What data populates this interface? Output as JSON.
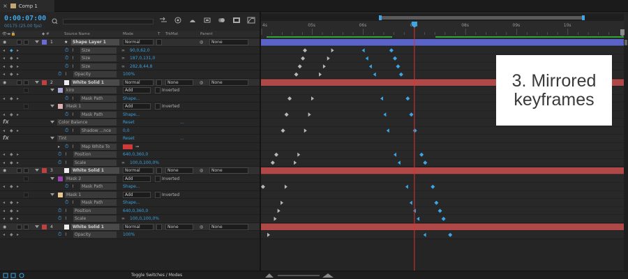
{
  "tab": {
    "title": "Comp 1"
  },
  "header": {
    "timecode": "0:00:07:00",
    "fps_label": "00175 (25.00 fps)"
  },
  "columns": {
    "source_name": "Source Name",
    "mode": "Mode",
    "t": "T",
    "trkmat": "TrkMat",
    "parent": "Parent"
  },
  "ruler": {
    "labels": [
      "4s",
      "05s",
      "06s",
      "07s",
      "08s",
      "09s",
      "10s"
    ]
  },
  "rows": [
    {
      "kind": "layer",
      "num": "1",
      "name": "Shape Layer 1",
      "label_color": "#6b6bd6",
      "mode": "Normal",
      "parent": "None",
      "star": true
    },
    {
      "kind": "prop",
      "indent": 2,
      "name": "Size",
      "value": "90,0,62,0",
      "icon": "stopwatch"
    },
    {
      "kind": "prop",
      "indent": 2,
      "name": "Size",
      "value": "187,0,131,0",
      "icon": "stopwatch"
    },
    {
      "kind": "prop",
      "indent": 2,
      "name": "Size",
      "value": "282,8,44,8",
      "icon": "stopwatch"
    },
    {
      "kind": "prop",
      "indent": 1,
      "name": "Opacity",
      "value": "100%",
      "icon": "stopwatch"
    },
    {
      "kind": "layer",
      "num": "2",
      "name": "White Solid 1",
      "label_color": "#c04040",
      "mode": "Normal",
      "trkmat": "None",
      "parent": "None"
    },
    {
      "kind": "mask",
      "name": "kiro",
      "mask_color": "#a9a9d8",
      "mode": "Add",
      "inverted": "Inverted"
    },
    {
      "kind": "prop",
      "indent": 2,
      "name": "Mask Path",
      "value": "Shape...",
      "icon": "stopwatch"
    },
    {
      "kind": "mask",
      "name": "Mask 1",
      "mask_color": "#e0b0b0",
      "mode": "Add",
      "inverted": "Inverted"
    },
    {
      "kind": "prop",
      "indent": 2,
      "name": "Mask Path",
      "value": "Shape...",
      "icon": "stopwatch"
    },
    {
      "kind": "effect",
      "name": "Color Balance",
      "value": "Reset",
      "extra": "..."
    },
    {
      "kind": "prop",
      "indent": 2,
      "name": "Shadow ...nce",
      "value": "0,0",
      "icon": "stopwatch"
    },
    {
      "kind": "effect",
      "name": "Tint",
      "value": "Reset",
      "extra": "..."
    },
    {
      "kind": "propcolor",
      "indent": 2,
      "name": "Map White To",
      "color": "#d23a3a"
    },
    {
      "kind": "prop",
      "indent": 1,
      "name": "Position",
      "value": "640,0,360,0",
      "icon": "stopwatch"
    },
    {
      "kind": "prop",
      "indent": 1,
      "name": "Scale",
      "value": "100,0,100,0%",
      "icon": "stopwatch"
    },
    {
      "kind": "layer",
      "num": "3",
      "name": "White Solid 1",
      "label_color": "#c04040",
      "mode": "Normal",
      "trkmat": "None",
      "parent": "None"
    },
    {
      "kind": "mask",
      "name": "Mask 2",
      "mask_color": "#9a40b0",
      "mode": "Add",
      "inverted": "Inverted"
    },
    {
      "kind": "prop",
      "indent": 2,
      "name": "Mask Path",
      "value": "Shape...",
      "icon": "stopwatch"
    },
    {
      "kind": "mask",
      "name": "Mask 1",
      "mask_color": "#e8c890",
      "mode": "Add",
      "inverted": "Inverted"
    },
    {
      "kind": "prop",
      "indent": 2,
      "name": "Mask Path",
      "value": "Shape...",
      "icon": "stopwatch"
    },
    {
      "kind": "prop",
      "indent": 1,
      "name": "Position",
      "value": "640,0,360,0",
      "icon": "stopwatch"
    },
    {
      "kind": "prop",
      "indent": 1,
      "name": "Scale",
      "value": "100,0,100,0%",
      "icon": "stopwatch"
    },
    {
      "kind": "layer",
      "num": "4",
      "name": "White Solid 1",
      "label_color": "#c04040",
      "mode": "Normal",
      "trkmat": "None",
      "parent": "None"
    },
    {
      "kind": "prop",
      "indent": 1,
      "name": "Opacity",
      "value": "100%",
      "icon": "stopwatch"
    }
  ],
  "keyframes": [
    {
      "row": 1,
      "times": [
        4.86,
        5.4,
        6.0,
        6.55
      ]
    },
    {
      "row": 2,
      "times": [
        4.82,
        5.32,
        6.07,
        6.62
      ]
    },
    {
      "row": 3,
      "times": [
        4.76,
        5.24,
        6.14,
        6.68
      ]
    },
    {
      "row": 4,
      "times": [
        4.69,
        5.16,
        6.22,
        6.74
      ]
    },
    {
      "row": 7,
      "times": [
        4.56,
        5.01,
        6.36,
        6.87
      ]
    },
    {
      "row": 9,
      "times": [
        4.5,
        4.95,
        6.42,
        6.94
      ]
    },
    {
      "row": 11,
      "times": [
        4.43,
        4.87,
        6.48,
        7.01
      ]
    },
    {
      "row": 14,
      "times": [
        4.3,
        4.74,
        6.62,
        7.14
      ]
    },
    {
      "row": 15,
      "times": [
        4.23,
        4.67,
        6.7,
        7.21
      ]
    },
    {
      "row": 18,
      "times": [
        4.04,
        4.49,
        6.85,
        7.36
      ]
    },
    {
      "row": 20,
      "times": [
        3.96,
        4.41,
        6.93,
        7.43
      ]
    },
    {
      "row": 21,
      "times": [
        3.9,
        4.35,
        7.0,
        7.5
      ]
    },
    {
      "row": 22,
      "times": [
        3.83,
        4.28,
        7.07,
        7.57
      ]
    },
    {
      "row": 24,
      "times": [
        3.7,
        4.15,
        7.2,
        7.7
      ]
    }
  ],
  "overlay": {
    "line1": "3. Mirrored",
    "line2": "keyframes"
  },
  "footer": {
    "toggle_label": "Toggle Switches / Modes"
  },
  "colors": {
    "accent": "#3ea6e6",
    "playhead": "#e03030",
    "layer_bar_blue": "#5a64c8",
    "layer_bar_red": "#b04848"
  }
}
